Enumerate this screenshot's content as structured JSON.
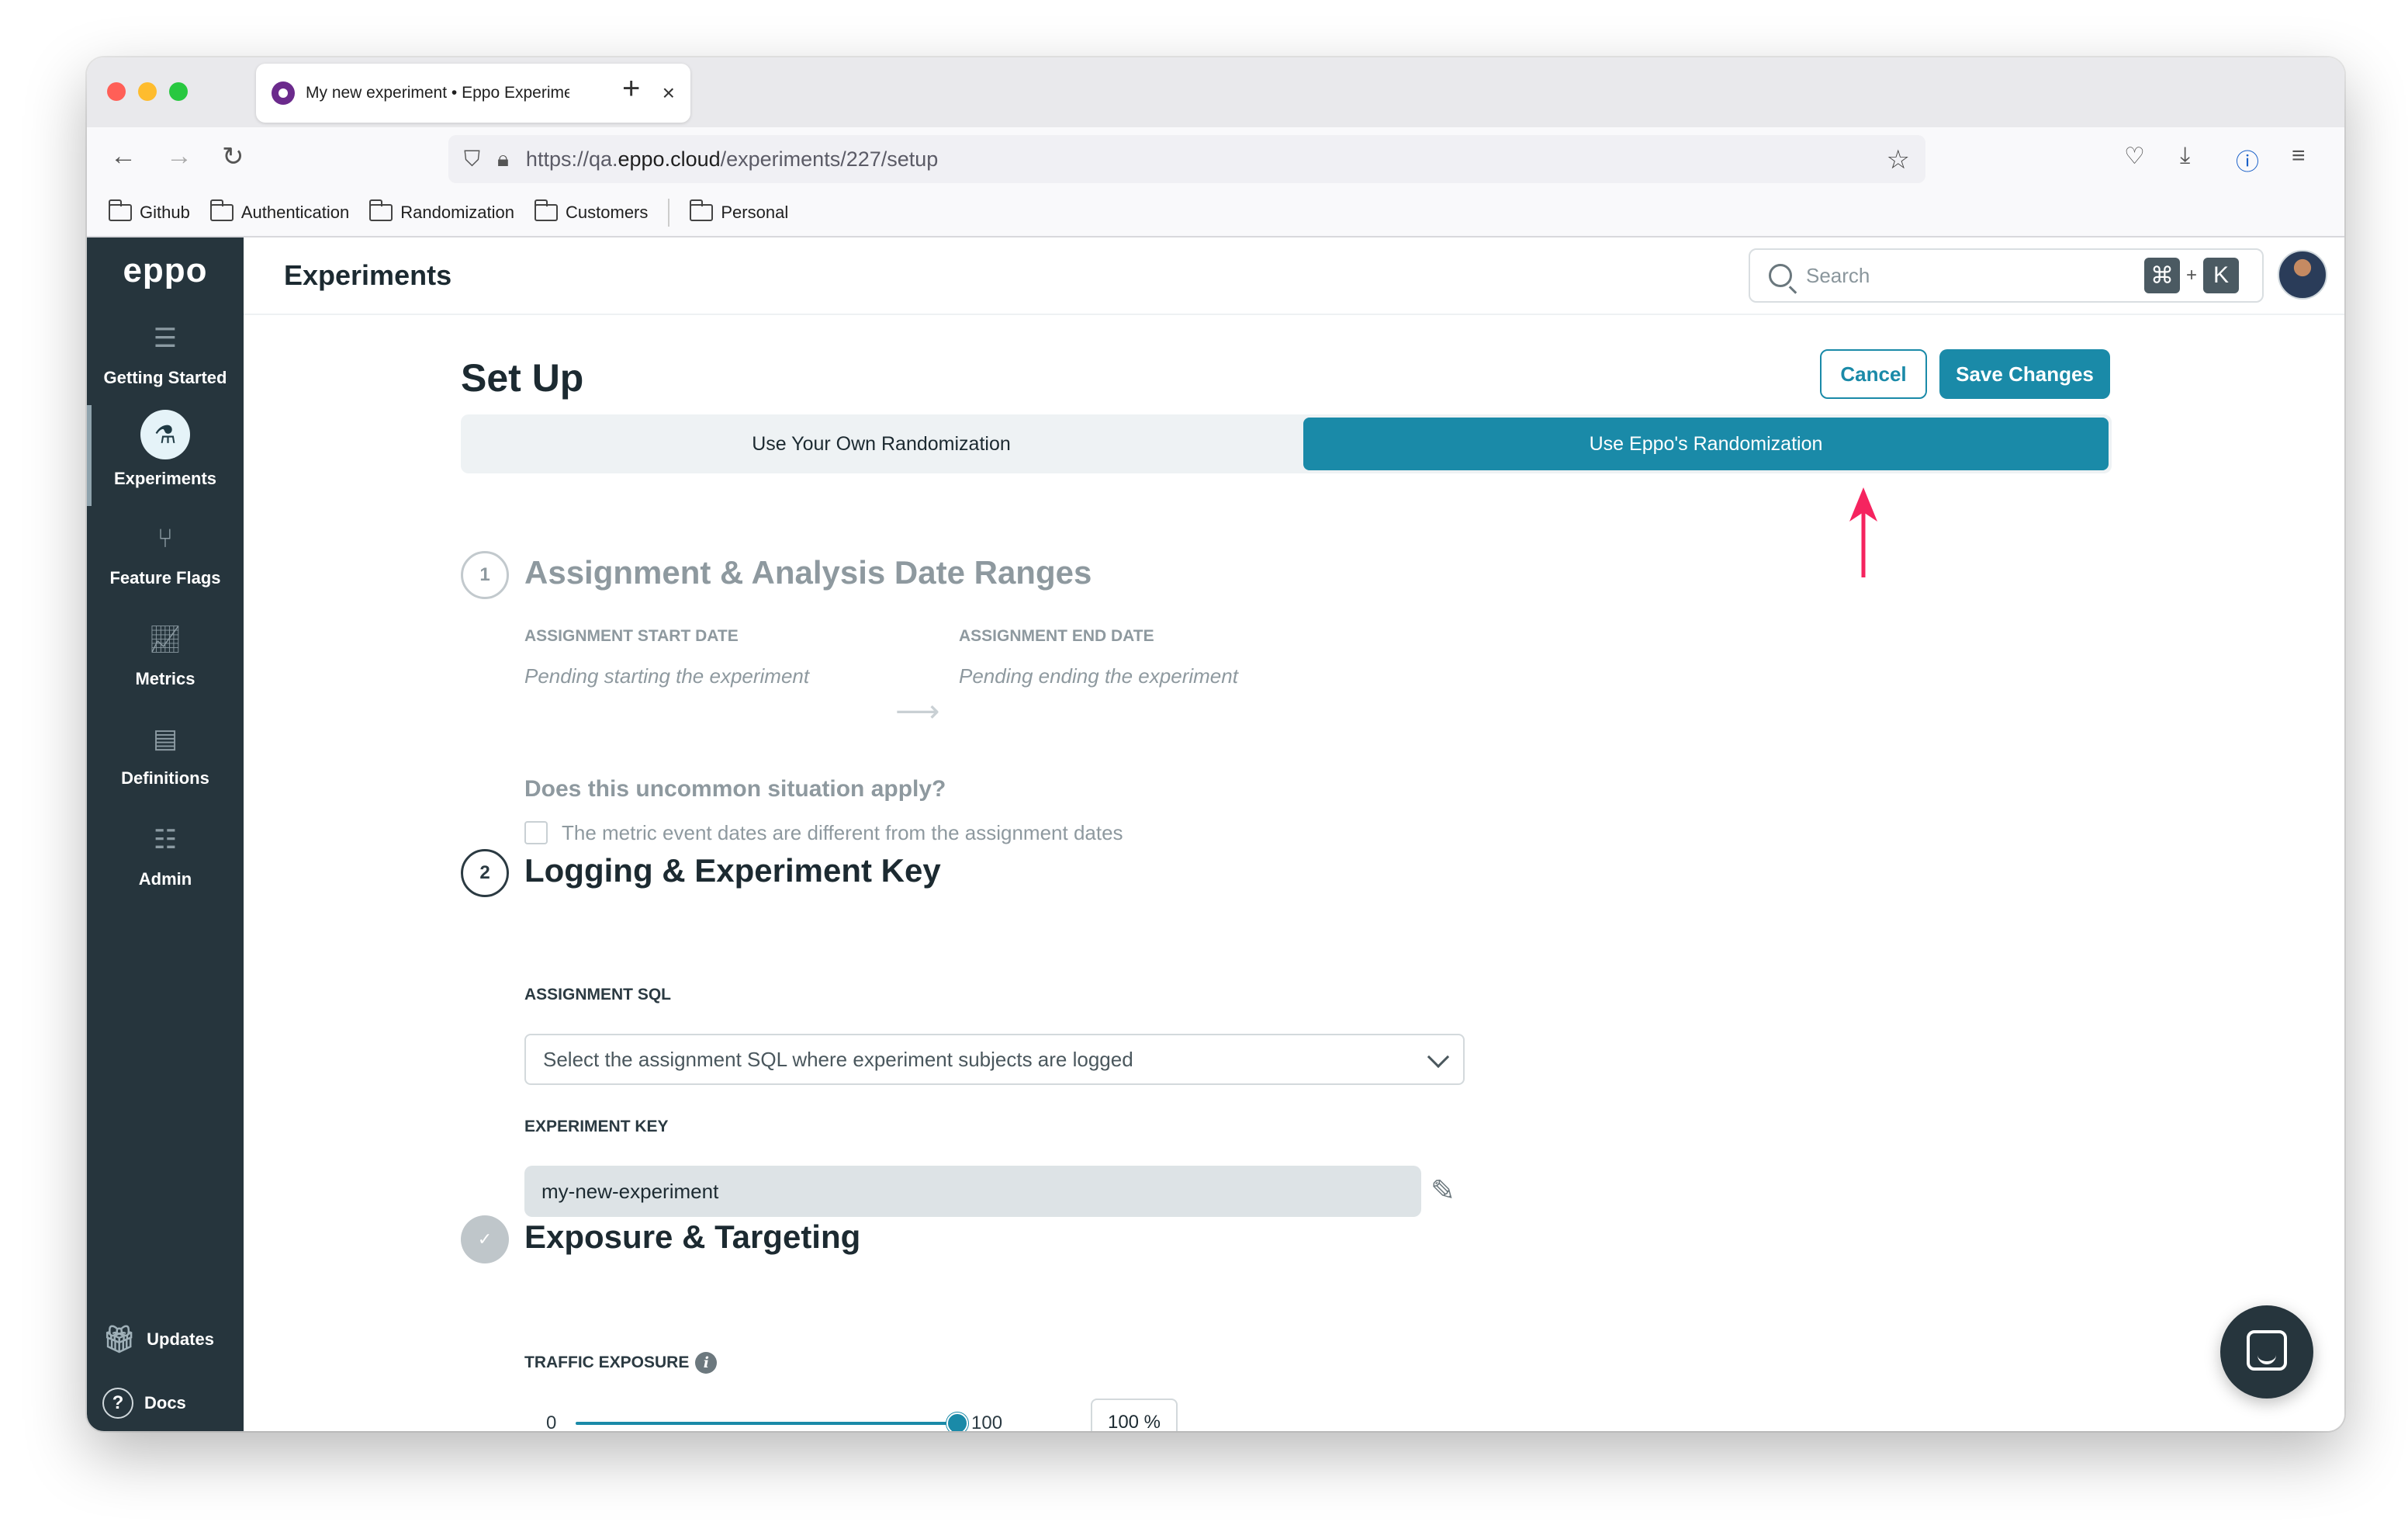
{
  "browser": {
    "tab_title": "My new experiment • Eppo Experiments",
    "url_prefix": "https://qa.",
    "url_domain": "eppo.cloud",
    "url_path": "/experiments/227/setup",
    "bookmarks": [
      "Github",
      "Authentication",
      "Randomization",
      "Customers",
      "Personal"
    ]
  },
  "sidebar": {
    "logo": "eppo",
    "items": [
      {
        "label": "Getting Started",
        "icon": "list-icon"
      },
      {
        "label": "Experiments",
        "icon": "flask-icon"
      },
      {
        "label": "Feature Flags",
        "icon": "branch-icon"
      },
      {
        "label": "Metrics",
        "icon": "chart-icon"
      },
      {
        "label": "Definitions",
        "icon": "book-icon"
      },
      {
        "label": "Admin",
        "icon": "sliders-icon"
      }
    ],
    "updates_label": "Updates",
    "docs_label": "Docs"
  },
  "header": {
    "title": "Experiments",
    "search_placeholder": "Search",
    "shortcut_cmd": "⌘",
    "shortcut_plus": "+",
    "shortcut_key": "K"
  },
  "setup": {
    "title": "Set Up",
    "cancel_label": "Cancel",
    "save_label": "Save Changes",
    "randomization_options": [
      "Use Your Own Randomization",
      "Use Eppo's Randomization"
    ],
    "selected_option": "Use Eppo's Randomization"
  },
  "section1": {
    "number": "1",
    "title": "Assignment & Analysis Date Ranges",
    "start_label": "ASSIGNMENT START DATE",
    "start_value": "Pending starting the experiment",
    "end_label": "ASSIGNMENT END DATE",
    "end_value": "Pending ending the experiment",
    "question": "Does this uncommon situation apply?",
    "checkbox_label": "The metric event dates are different from the assignment dates"
  },
  "section2": {
    "number": "2",
    "title": "Logging & Experiment Key",
    "sql_label": "ASSIGNMENT SQL",
    "sql_placeholder": "Select the assignment SQL where experiment subjects are logged",
    "key_label": "EXPERIMENT KEY",
    "key_value": "my-new-experiment"
  },
  "section3": {
    "check": "✓",
    "title": "Exposure & Targeting",
    "traffic_label": "TRAFFIC EXPOSURE",
    "slider_min": "0",
    "slider_max": "100",
    "traffic_value": "100 %",
    "traffic_fraction": 1.0
  },
  "colors": {
    "accent": "#1a8aa8",
    "sidebar_bg": "#26353d",
    "annotation_arrow": "#f5245f"
  }
}
